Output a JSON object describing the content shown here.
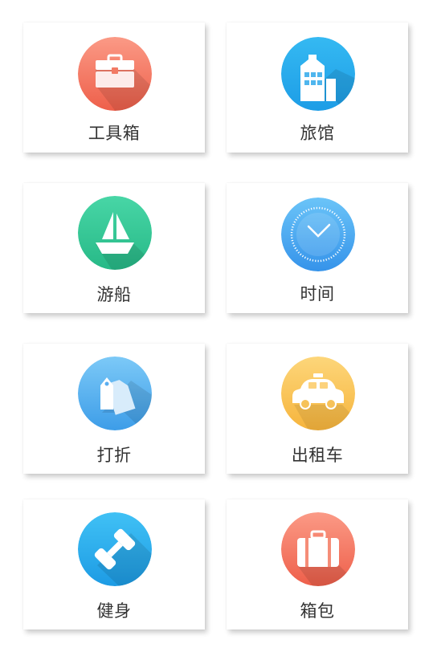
{
  "tiles": [
    {
      "label": "工具箱",
      "icon": "toolbox-icon",
      "color_top": "#fb9a86",
      "color_bottom": "#ee5f4a"
    },
    {
      "label": "旅馆",
      "icon": "hotel-icon",
      "color_top": "#35b9f2",
      "color_bottom": "#1d9de6"
    },
    {
      "label": "游船",
      "icon": "sailboat-icon",
      "color_top": "#48d6a6",
      "color_bottom": "#27b987"
    },
    {
      "label": "时间",
      "icon": "clock-icon",
      "color_top": "#6bc4f8",
      "color_bottom": "#3593ea"
    },
    {
      "label": "打折",
      "icon": "price-tag-icon",
      "color_top": "#7cc9f7",
      "color_bottom": "#3d9de8"
    },
    {
      "label": "出租车",
      "icon": "taxi-icon",
      "color_top": "#fdd67a",
      "color_bottom": "#f6b43c"
    },
    {
      "label": "健身",
      "icon": "dumbbell-icon",
      "color_top": "#40c1f5",
      "color_bottom": "#1d9be4"
    },
    {
      "label": "箱包",
      "icon": "suitcase-icon",
      "color_top": "#fb9a86",
      "color_bottom": "#ee5f4a"
    }
  ]
}
